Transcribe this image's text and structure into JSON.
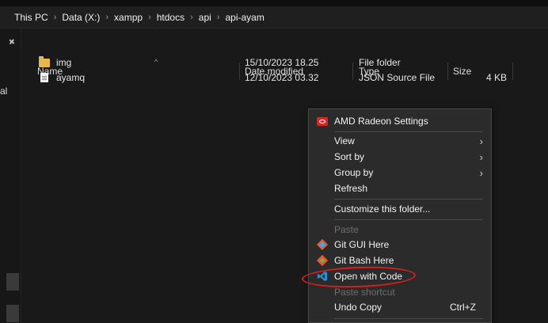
{
  "breadcrumb": {
    "items": [
      "This PC",
      "Data (X:)",
      "xampp",
      "htdocs",
      "api",
      "api-ayam"
    ]
  },
  "sidebar": {
    "partial_label": "al"
  },
  "columns": {
    "name": "Name",
    "date_modified": "Date modified",
    "type": "Type",
    "size": "Size"
  },
  "files": [
    {
      "name": "img",
      "date": "15/10/2023 18.25",
      "type": "File folder",
      "size": "",
      "icon": "folder-icon"
    },
    {
      "name": "ayamq",
      "date": "12/10/2023 03.32",
      "type": "JSON Source File",
      "size": "4 KB",
      "icon": "file-icon"
    }
  ],
  "context_menu": {
    "amd": "AMD Radeon Settings",
    "view": "View",
    "sort_by": "Sort by",
    "group_by": "Group by",
    "refresh": "Refresh",
    "customize": "Customize this folder...",
    "paste": "Paste",
    "git_gui": "Git GUI Here",
    "git_bash": "Git Bash Here",
    "open_with_code": "Open with Code",
    "paste_shortcut": "Paste shortcut",
    "undo_copy": "Undo Copy",
    "undo_shortcut": "Ctrl+Z"
  },
  "colors": {
    "background": "#191919",
    "menu_bg": "#2b2b2b",
    "folder": "#e8b84a",
    "vscode_blue": "#2a8fd8",
    "annotation_red": "#d42020"
  }
}
